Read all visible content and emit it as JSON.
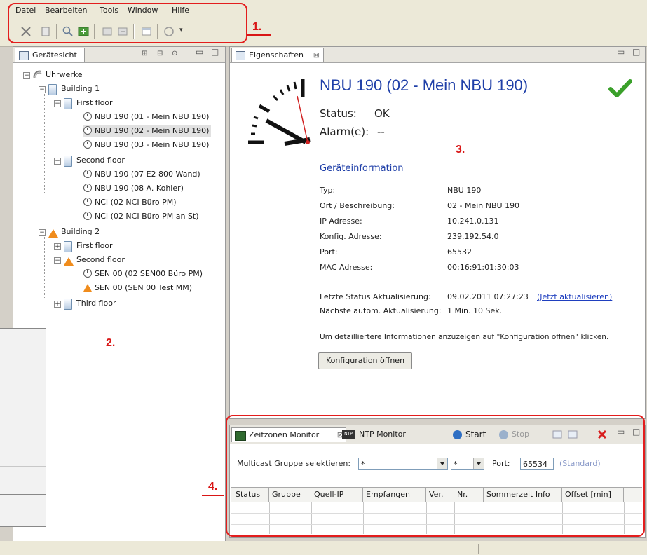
{
  "menu": [
    "Datei",
    "Bearbeiten",
    "Tools",
    "Window",
    "Hilfe"
  ],
  "annotations": {
    "one": "1.",
    "two": "2.",
    "three": "3.",
    "four": "4."
  },
  "left_panel": {
    "tab_label": "Gerätesicht",
    "root": "Uhrwerke",
    "building1": "Building 1",
    "b1_first_floor": "First floor",
    "b1_ff_items": [
      "NBU 190 (01 - Mein NBU 190)",
      "NBU 190 (02 - Mein NBU 190)",
      "NBU 190 (03 - Mein NBU 190)"
    ],
    "b1_second_floor": "Second floor",
    "b1_sf_items": [
      "NBU 190 (07 E2 800 Wand)",
      "NBU 190 (08 A. Kohler)",
      "NCI (02 NCI Büro PM)",
      "NCI (02 NCI Büro PM an St)"
    ],
    "building2": "Building 2",
    "b2_first_floor": "First floor",
    "b2_second_floor": "Second floor",
    "b2_sf_items": [
      "SEN 00 (02 SEN00 Büro PM)",
      "SEN 00 (SEN 00 Test MM)"
    ],
    "b2_third_floor": "Third floor"
  },
  "properties": {
    "tab_label": "Eigenschaften",
    "title": "NBU 190 (02 - Mein NBU 190)",
    "status_label": "Status:",
    "status_value": "OK",
    "alarm_label": "Alarm(e):",
    "alarm_value": "--",
    "section_title": "Geräteinformation",
    "rows": [
      {
        "k": "Typ:",
        "v": "NBU 190"
      },
      {
        "k": "Ort / Beschreibung:",
        "v": "02 - Mein NBU 190"
      },
      {
        "k": "IP Adresse:",
        "v": "10.241.0.131"
      },
      {
        "k": "Konfig. Adresse:",
        "v": "239.192.54.0"
      },
      {
        "k": "Port:",
        "v": "65532"
      },
      {
        "k": "MAC Adresse:",
        "v": "00:16:91:01:30:03"
      }
    ],
    "last_update_label": "Letzte Status Aktualisierung:",
    "last_update_value": "09.02.2011 07:27:23",
    "update_now_link": "(Jetzt aktualisieren)",
    "next_update_label": "Nächste autom. Aktualisierung:",
    "next_update_value": "1 Min. 10 Sek.",
    "hint": "Um detailliertere Informationen anzuzeigen auf \"Konfiguration öffnen\" klicken.",
    "open_config_button": "Konfiguration öffnen"
  },
  "monitor": {
    "tab1": "Zeitzonen Monitor",
    "tab2": "NTP Monitor",
    "start": "Start",
    "stop": "Stop",
    "multicast_label": "Multicast Gruppe selektieren:",
    "multicast_value": "*",
    "second_value": "*",
    "port_label": "Port:",
    "port_value": "65534",
    "standard_link": "(Standard)",
    "columns": [
      "Status",
      "Gruppe",
      "Quell-IP",
      "Empfangen",
      "Ver.",
      "Nr.",
      "Sommerzeit Info",
      "Offset [min]"
    ]
  },
  "colors": {
    "accent_red": "#e31d1d",
    "link": "#1f3fbf",
    "title_blue": "#1f3fa8",
    "ok_green": "#3aa02a"
  }
}
